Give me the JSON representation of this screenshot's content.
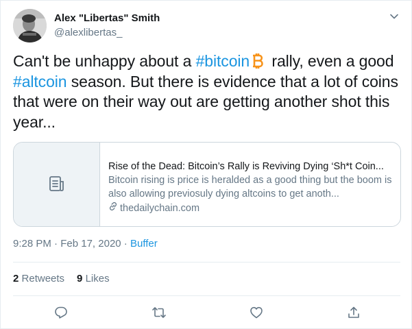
{
  "author": {
    "display_name": "Alex \"Libertas\" Smith",
    "handle": "@alexlibertas_"
  },
  "tweet": {
    "text_1": "Can't be unhappy about a ",
    "hashtag_1": "#bitcoin",
    "text_2": " rally, even a good ",
    "hashtag_2": "#altcoin",
    "text_3": " season. But there is evidence that a lot of coins that were on their way out are getting another shot this year..."
  },
  "card": {
    "title": "Rise of the Dead: Bitcoin’s Rally is Reviving Dying ‘Sh*t Coin...",
    "description": "Bitcoin rising is price is heralded as a good thing but the boom is also allowing previosuly dying altcoins to get anoth...",
    "domain": "thedailychain.com"
  },
  "meta": {
    "time": "9:28 PM",
    "sep1": " · ",
    "date": "Feb 17, 2020",
    "sep2": " · ",
    "via": "Buffer"
  },
  "stats": {
    "retweets_count": "2",
    "retweets_label": "Retweets",
    "likes_count": "9",
    "likes_label": "Likes"
  },
  "icons": {
    "caret": "chevron-down-icon",
    "bitcoin": "bitcoin-icon",
    "card_placeholder": "document-icon",
    "link": "link-icon",
    "reply": "reply-icon",
    "retweet": "retweet-icon",
    "like": "heart-icon",
    "share": "share-icon"
  },
  "colors": {
    "link": "#1b95e0",
    "secondary_text": "#657786",
    "bitcoin": "#f7931a"
  }
}
